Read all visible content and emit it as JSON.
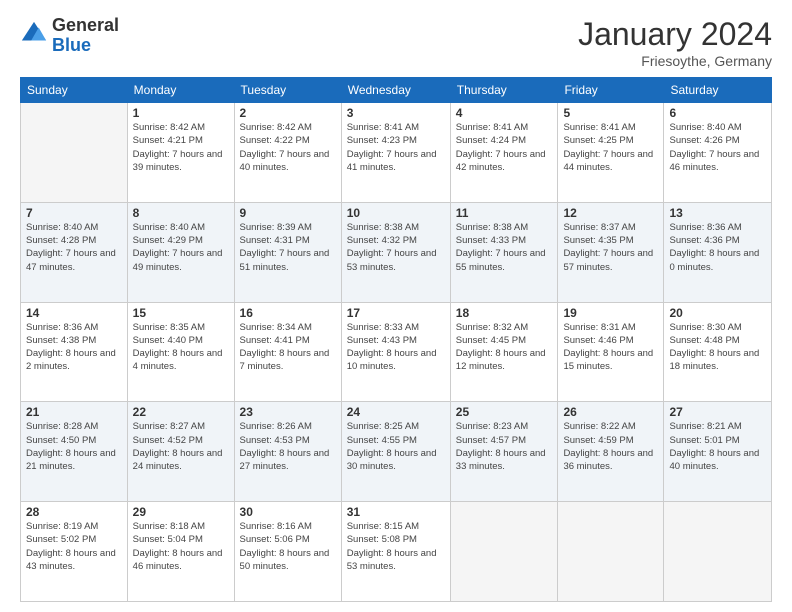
{
  "logo": {
    "general": "General",
    "blue": "Blue"
  },
  "title": "January 2024",
  "subtitle": "Friesoythe, Germany",
  "days_of_week": [
    "Sunday",
    "Monday",
    "Tuesday",
    "Wednesday",
    "Thursday",
    "Friday",
    "Saturday"
  ],
  "weeks": [
    [
      {
        "num": "",
        "empty": true
      },
      {
        "num": "1",
        "sunrise": "Sunrise: 8:42 AM",
        "sunset": "Sunset: 4:21 PM",
        "daylight": "Daylight: 7 hours and 39 minutes."
      },
      {
        "num": "2",
        "sunrise": "Sunrise: 8:42 AM",
        "sunset": "Sunset: 4:22 PM",
        "daylight": "Daylight: 7 hours and 40 minutes."
      },
      {
        "num": "3",
        "sunrise": "Sunrise: 8:41 AM",
        "sunset": "Sunset: 4:23 PM",
        "daylight": "Daylight: 7 hours and 41 minutes."
      },
      {
        "num": "4",
        "sunrise": "Sunrise: 8:41 AM",
        "sunset": "Sunset: 4:24 PM",
        "daylight": "Daylight: 7 hours and 42 minutes."
      },
      {
        "num": "5",
        "sunrise": "Sunrise: 8:41 AM",
        "sunset": "Sunset: 4:25 PM",
        "daylight": "Daylight: 7 hours and 44 minutes."
      },
      {
        "num": "6",
        "sunrise": "Sunrise: 8:40 AM",
        "sunset": "Sunset: 4:26 PM",
        "daylight": "Daylight: 7 hours and 46 minutes."
      }
    ],
    [
      {
        "num": "7",
        "sunrise": "Sunrise: 8:40 AM",
        "sunset": "Sunset: 4:28 PM",
        "daylight": "Daylight: 7 hours and 47 minutes."
      },
      {
        "num": "8",
        "sunrise": "Sunrise: 8:40 AM",
        "sunset": "Sunset: 4:29 PM",
        "daylight": "Daylight: 7 hours and 49 minutes."
      },
      {
        "num": "9",
        "sunrise": "Sunrise: 8:39 AM",
        "sunset": "Sunset: 4:31 PM",
        "daylight": "Daylight: 7 hours and 51 minutes."
      },
      {
        "num": "10",
        "sunrise": "Sunrise: 8:38 AM",
        "sunset": "Sunset: 4:32 PM",
        "daylight": "Daylight: 7 hours and 53 minutes."
      },
      {
        "num": "11",
        "sunrise": "Sunrise: 8:38 AM",
        "sunset": "Sunset: 4:33 PM",
        "daylight": "Daylight: 7 hours and 55 minutes."
      },
      {
        "num": "12",
        "sunrise": "Sunrise: 8:37 AM",
        "sunset": "Sunset: 4:35 PM",
        "daylight": "Daylight: 7 hours and 57 minutes."
      },
      {
        "num": "13",
        "sunrise": "Sunrise: 8:36 AM",
        "sunset": "Sunset: 4:36 PM",
        "daylight": "Daylight: 8 hours and 0 minutes."
      }
    ],
    [
      {
        "num": "14",
        "sunrise": "Sunrise: 8:36 AM",
        "sunset": "Sunset: 4:38 PM",
        "daylight": "Daylight: 8 hours and 2 minutes."
      },
      {
        "num": "15",
        "sunrise": "Sunrise: 8:35 AM",
        "sunset": "Sunset: 4:40 PM",
        "daylight": "Daylight: 8 hours and 4 minutes."
      },
      {
        "num": "16",
        "sunrise": "Sunrise: 8:34 AM",
        "sunset": "Sunset: 4:41 PM",
        "daylight": "Daylight: 8 hours and 7 minutes."
      },
      {
        "num": "17",
        "sunrise": "Sunrise: 8:33 AM",
        "sunset": "Sunset: 4:43 PM",
        "daylight": "Daylight: 8 hours and 10 minutes."
      },
      {
        "num": "18",
        "sunrise": "Sunrise: 8:32 AM",
        "sunset": "Sunset: 4:45 PM",
        "daylight": "Daylight: 8 hours and 12 minutes."
      },
      {
        "num": "19",
        "sunrise": "Sunrise: 8:31 AM",
        "sunset": "Sunset: 4:46 PM",
        "daylight": "Daylight: 8 hours and 15 minutes."
      },
      {
        "num": "20",
        "sunrise": "Sunrise: 8:30 AM",
        "sunset": "Sunset: 4:48 PM",
        "daylight": "Daylight: 8 hours and 18 minutes."
      }
    ],
    [
      {
        "num": "21",
        "sunrise": "Sunrise: 8:28 AM",
        "sunset": "Sunset: 4:50 PM",
        "daylight": "Daylight: 8 hours and 21 minutes."
      },
      {
        "num": "22",
        "sunrise": "Sunrise: 8:27 AM",
        "sunset": "Sunset: 4:52 PM",
        "daylight": "Daylight: 8 hours and 24 minutes."
      },
      {
        "num": "23",
        "sunrise": "Sunrise: 8:26 AM",
        "sunset": "Sunset: 4:53 PM",
        "daylight": "Daylight: 8 hours and 27 minutes."
      },
      {
        "num": "24",
        "sunrise": "Sunrise: 8:25 AM",
        "sunset": "Sunset: 4:55 PM",
        "daylight": "Daylight: 8 hours and 30 minutes."
      },
      {
        "num": "25",
        "sunrise": "Sunrise: 8:23 AM",
        "sunset": "Sunset: 4:57 PM",
        "daylight": "Daylight: 8 hours and 33 minutes."
      },
      {
        "num": "26",
        "sunrise": "Sunrise: 8:22 AM",
        "sunset": "Sunset: 4:59 PM",
        "daylight": "Daylight: 8 hours and 36 minutes."
      },
      {
        "num": "27",
        "sunrise": "Sunrise: 8:21 AM",
        "sunset": "Sunset: 5:01 PM",
        "daylight": "Daylight: 8 hours and 40 minutes."
      }
    ],
    [
      {
        "num": "28",
        "sunrise": "Sunrise: 8:19 AM",
        "sunset": "Sunset: 5:02 PM",
        "daylight": "Daylight: 8 hours and 43 minutes."
      },
      {
        "num": "29",
        "sunrise": "Sunrise: 8:18 AM",
        "sunset": "Sunset: 5:04 PM",
        "daylight": "Daylight: 8 hours and 46 minutes."
      },
      {
        "num": "30",
        "sunrise": "Sunrise: 8:16 AM",
        "sunset": "Sunset: 5:06 PM",
        "daylight": "Daylight: 8 hours and 50 minutes."
      },
      {
        "num": "31",
        "sunrise": "Sunrise: 8:15 AM",
        "sunset": "Sunset: 5:08 PM",
        "daylight": "Daylight: 8 hours and 53 minutes."
      },
      {
        "num": "",
        "empty": true
      },
      {
        "num": "",
        "empty": true
      },
      {
        "num": "",
        "empty": true
      }
    ]
  ]
}
